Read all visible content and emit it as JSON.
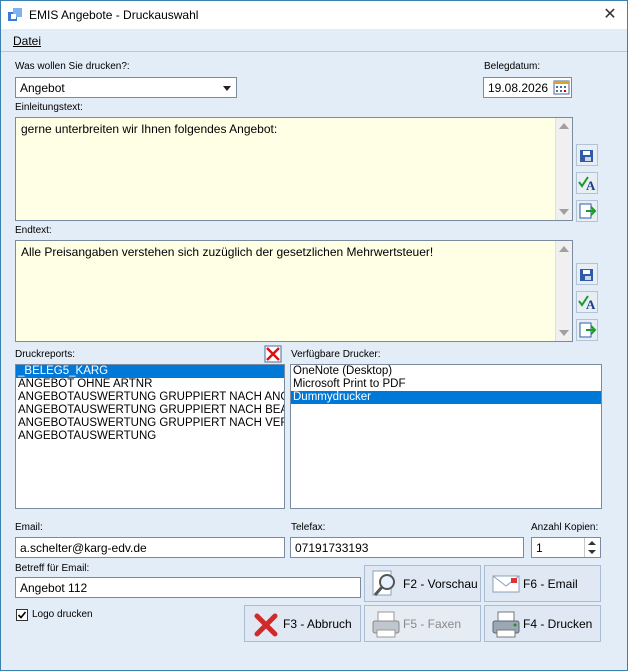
{
  "window": {
    "title": "EMIS Angebote - Druckauswahl",
    "close_glyph": "✕"
  },
  "menu": {
    "datei": "Datei"
  },
  "fields": {
    "print_what_label": "Was wollen Sie drucken?:",
    "print_what_value": "Angebot",
    "beleg_label": "Belegdatum:",
    "beleg_value": "19.08.2026",
    "intro_label": "Einleitungstext:",
    "intro_value": "gerne unterbreiten wir Ihnen folgendes Angebot:",
    "end_label": "Endtext:",
    "end_value": "Alle Preisangaben verstehen sich zuzüglich der gesetzlichen Mehrwertsteuer!",
    "reports_label": "Druckreports:",
    "printers_label": "Verfügbare Drucker:",
    "email_label": "Email:",
    "email_value": "a.schelter@karg-edv.de",
    "fax_label": "Telefax:",
    "fax_value": "07191733193",
    "copies_label": "Anzahl Kopien:",
    "copies_value": "1",
    "subject_label": "Betreff für Email:",
    "subject_value": "Angebot 112",
    "logo_label": "Logo drucken"
  },
  "reports": [
    "_BELEG5_KARG",
    "ANGEBOT OHNE ARTNR",
    "ANGEBOTAUSWERTUNG GRUPPIERT NACH ANGEL",
    "ANGEBOTAUSWERTUNG GRUPPIERT NACH BEARBE",
    "ANGEBOTAUSWERTUNG GRUPPIERT NACH VERTF",
    "ANGEBOTAUSWERTUNG"
  ],
  "printers": [
    "OneNote (Desktop)",
    "Microsoft Print to PDF",
    "Dummydrucker"
  ],
  "buttons": {
    "preview": "F2 - Vorschau",
    "email": "F6 - Email",
    "cancel": "F3 - Abbruch",
    "fax": "F5 - Faxen",
    "print": "F4 - Drucken"
  },
  "colors": {
    "selection": "#0078d7",
    "textarea_bg": "#ffffe6",
    "window_bg": "#e3edf8"
  }
}
